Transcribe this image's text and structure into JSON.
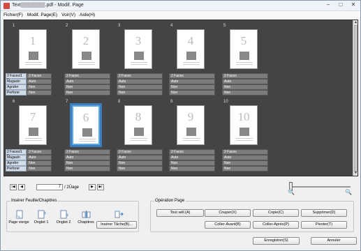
{
  "window": {
    "title": "Text▒▒▒▒▒▒▒.pdf - Modif. Page",
    "min": "–",
    "max": "□",
    "close": "✕"
  },
  "menu": [
    "Fichier(F)",
    "Modif. Page(E)",
    "Voir(V)",
    "Aide(H)"
  ],
  "prop_labels": [
    "2 Faces/1 Face",
    "Magasin",
    "Agrafer",
    "Perforer"
  ],
  "pages": [
    {
      "num": "1",
      "props": [
        "2 Faces",
        "Auto",
        "Non",
        "Non"
      ],
      "selected": false
    },
    {
      "num": "2",
      "props": [
        "2 Faces",
        "Auto",
        "Non",
        "Non"
      ],
      "selected": false
    },
    {
      "num": "3",
      "props": [
        "2 Faces",
        "Auto",
        "Non",
        "Non"
      ],
      "selected": false
    },
    {
      "num": "4",
      "props": [
        "2 Faces",
        "Auto",
        "Non",
        "Non"
      ],
      "selected": false
    },
    {
      "num": "5",
      "props": [
        "2 Faces",
        "Auto",
        "Non",
        "Non"
      ],
      "selected": false
    },
    {
      "num": "6",
      "thumb": "7",
      "props": [
        "2 Faces",
        "Auto",
        "Non",
        "Non"
      ],
      "selected": false
    },
    {
      "num": "7",
      "thumb": "6",
      "props": [
        "2 Faces",
        "Auto",
        "Non",
        "Non"
      ],
      "selected": true
    },
    {
      "num": "8",
      "thumb": "8",
      "props": [
        "2 Faces",
        "Auto",
        "Non",
        "Non"
      ],
      "selected": false
    },
    {
      "num": "9",
      "thumb": "9",
      "props": [
        "2 Faces",
        "Auto",
        "Non",
        "Non"
      ],
      "selected": false
    },
    {
      "num": "10",
      "thumb": "10",
      "props": [
        "2 Faces",
        "Auto",
        "Non",
        "Non"
      ],
      "selected": false
    }
  ],
  "nav": {
    "first": "|◀",
    "prev": "◀",
    "next": "▶",
    "last": "▶|",
    "current": "7",
    "total": "/ 2Ûage"
  },
  "zoom": {
    "out_icon": "zoom-out-icon",
    "in_icon": "zoom-in-icon",
    "level": 0.0
  },
  "insert_group": {
    "legend": "Insérer Feuille/Chapitres",
    "items": [
      "Page vierge",
      "Onglet 1",
      "Onglet 2",
      "Chapitres"
    ],
    "task_button": "Insérer Tâche(B)..."
  },
  "ops_group": {
    "legend": "Opération Page",
    "buttons": [
      "Tout séll.(A)",
      "Couper(X)",
      "Copie(C)",
      "Supprimer(D)",
      "Coller-Avant(B)",
      "Coller-Après(P)",
      "Pivoter(T)"
    ]
  },
  "footer": {
    "save": "Enregistrer(S)",
    "cancel": "Annuler"
  },
  "colors": {
    "viewer_bg": "#444444",
    "selected_border": "#3b7dbd",
    "prop_label_bg": "#d3dce9",
    "prop_value_bg": "#7c7c7c"
  }
}
